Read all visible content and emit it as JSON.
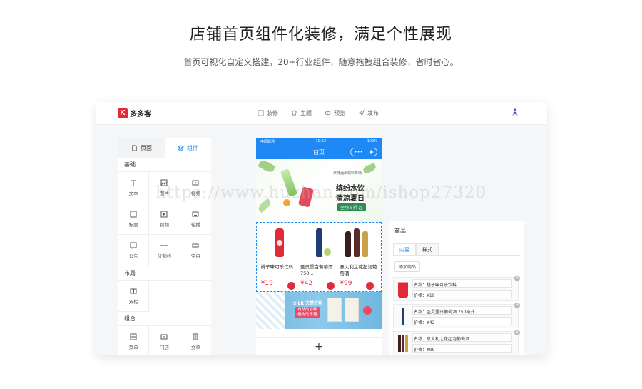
{
  "hero": {
    "title": "店铺首页组件化装修，满足个性展现",
    "subtitle": "首页可视化自定义搭建，20+行业组件，随意拖拽组合装修，省时省心。"
  },
  "app": {
    "logo_mark": "K",
    "logo_text": "多多客",
    "nav": [
      {
        "label": "装修",
        "icon": "decorate-icon"
      },
      {
        "label": "主题",
        "icon": "theme-icon"
      },
      {
        "label": "预览",
        "icon": "eye-icon"
      },
      {
        "label": "发布",
        "icon": "send-icon"
      }
    ]
  },
  "left_panel": {
    "tabs": [
      {
        "label": "页面",
        "active": false
      },
      {
        "label": "组件",
        "active": true
      }
    ],
    "sections": [
      {
        "title": "基础",
        "items": [
          "文本",
          "图片",
          "视频",
          "标题",
          "视频",
          "轮播",
          "公告",
          "分割线",
          "空白"
        ]
      },
      {
        "title": "布局",
        "items": [
          "双栏"
        ]
      },
      {
        "title": "组合",
        "items": [
          "菜单",
          "门店",
          "文章"
        ]
      }
    ]
  },
  "phone": {
    "carrier": "中国联通",
    "time": "19:53",
    "battery": "100%",
    "title": "首页",
    "capsule_more": "•••",
    "capsule_close": "◉",
    "banner": {
      "small": "果味酒水饮料专场",
      "line1": "缤纷水饮",
      "line2": "清凉夏日",
      "pill": "全场 5折 起"
    },
    "goods": [
      {
        "name": "桃子味可乐饮料",
        "price": "¥19"
      },
      {
        "name": "圣灵堡白葡萄酒 750...",
        "price": "¥42"
      },
      {
        "name": "意大利之花起泡葡萄酒",
        "price": "¥99"
      }
    ],
    "banner2": {
      "brand": "SILK 天然豆乳",
      "tag_line1": "自然的滋味",
      "tag_line2": "植物的乐趣"
    },
    "add": "+"
  },
  "right_panel": {
    "title": "商品",
    "tabs": [
      {
        "label": "内容",
        "active": true
      },
      {
        "label": "样式",
        "active": false
      }
    ],
    "add_label": "添加商品",
    "items": [
      {
        "name": "名称：桃子味可乐饮料",
        "price": "价格：¥19"
      },
      {
        "name": "名称：圣灵堡白葡萄酒 750毫升",
        "price": "价格：¥42"
      },
      {
        "name": "名称：意大利之花起泡葡萄酒",
        "price": "价格：¥99"
      }
    ]
  },
  "watermark": "https://www.huzhan.com/ishop27320",
  "colors": {
    "accent": "#1989fa",
    "brand_red": "#e02b3d",
    "phone_header": "#1e88f5"
  }
}
